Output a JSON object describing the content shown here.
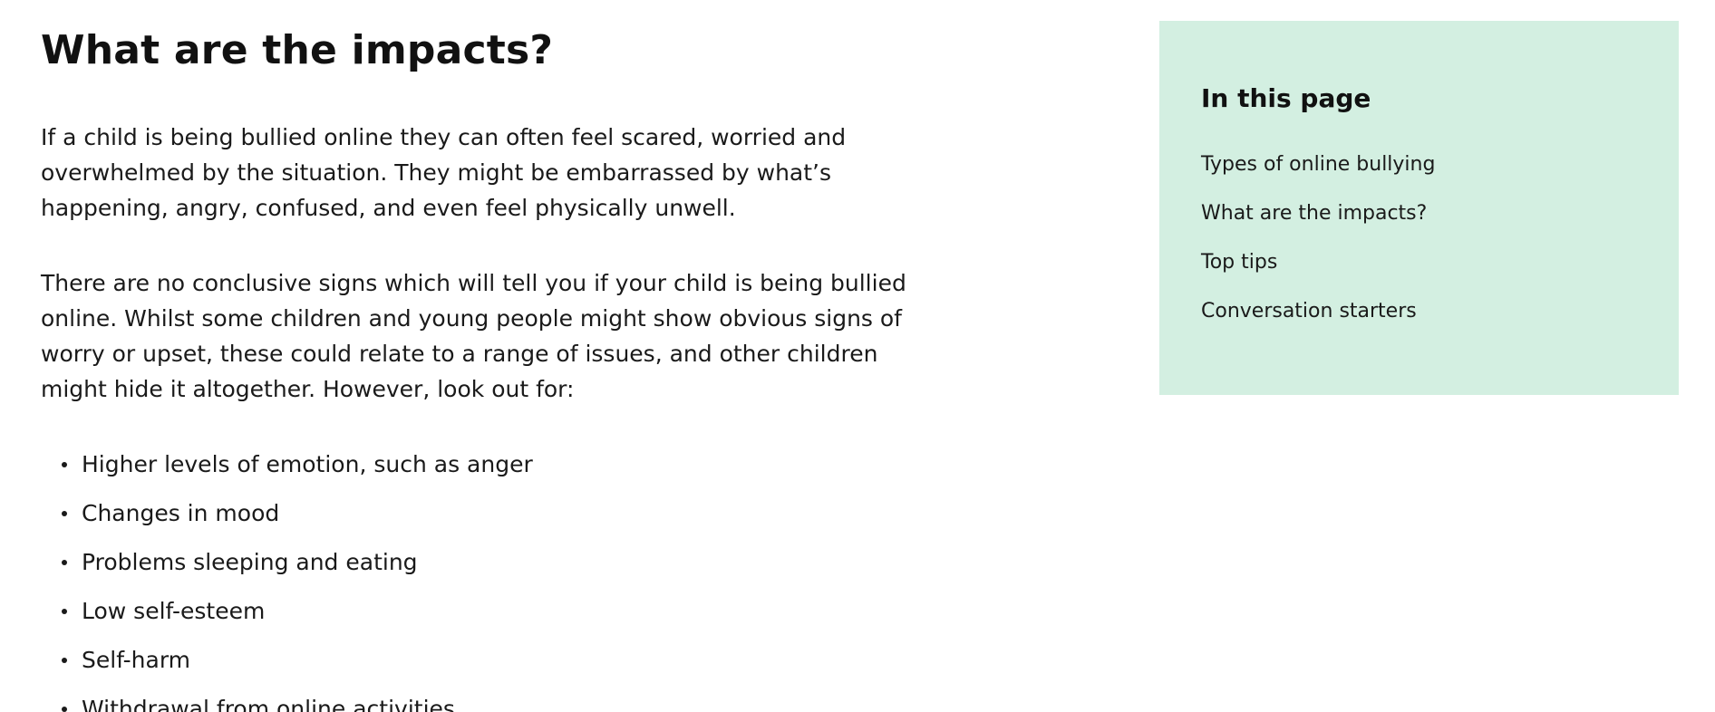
{
  "main": {
    "title": "What are the impacts?",
    "paragraphs": [
      "If a child is being bullied online they can often feel scared, worried and overwhelmed by the situation. They might be embarrassed by what’s happening, angry, confused, and even feel physically unwell.",
      "There are no conclusive signs which will tell you if your child is being bullied online. Whilst some children and young people might show obvious signs of worry or upset, these could relate to a range of issues, and other children might hide it altogether. However, look out for:"
    ],
    "bullets": [
      "Higher levels of emotion, such as anger",
      "Changes in mood",
      "Problems sleeping and eating",
      "Low self-esteem",
      "Self-harm",
      "Withdrawal from online activities"
    ]
  },
  "toc": {
    "heading": "In this page",
    "links": [
      "Types of online bullying",
      "What are the impacts?",
      "Top tips",
      "Conversation starters"
    ],
    "background": "#d3efe1"
  }
}
